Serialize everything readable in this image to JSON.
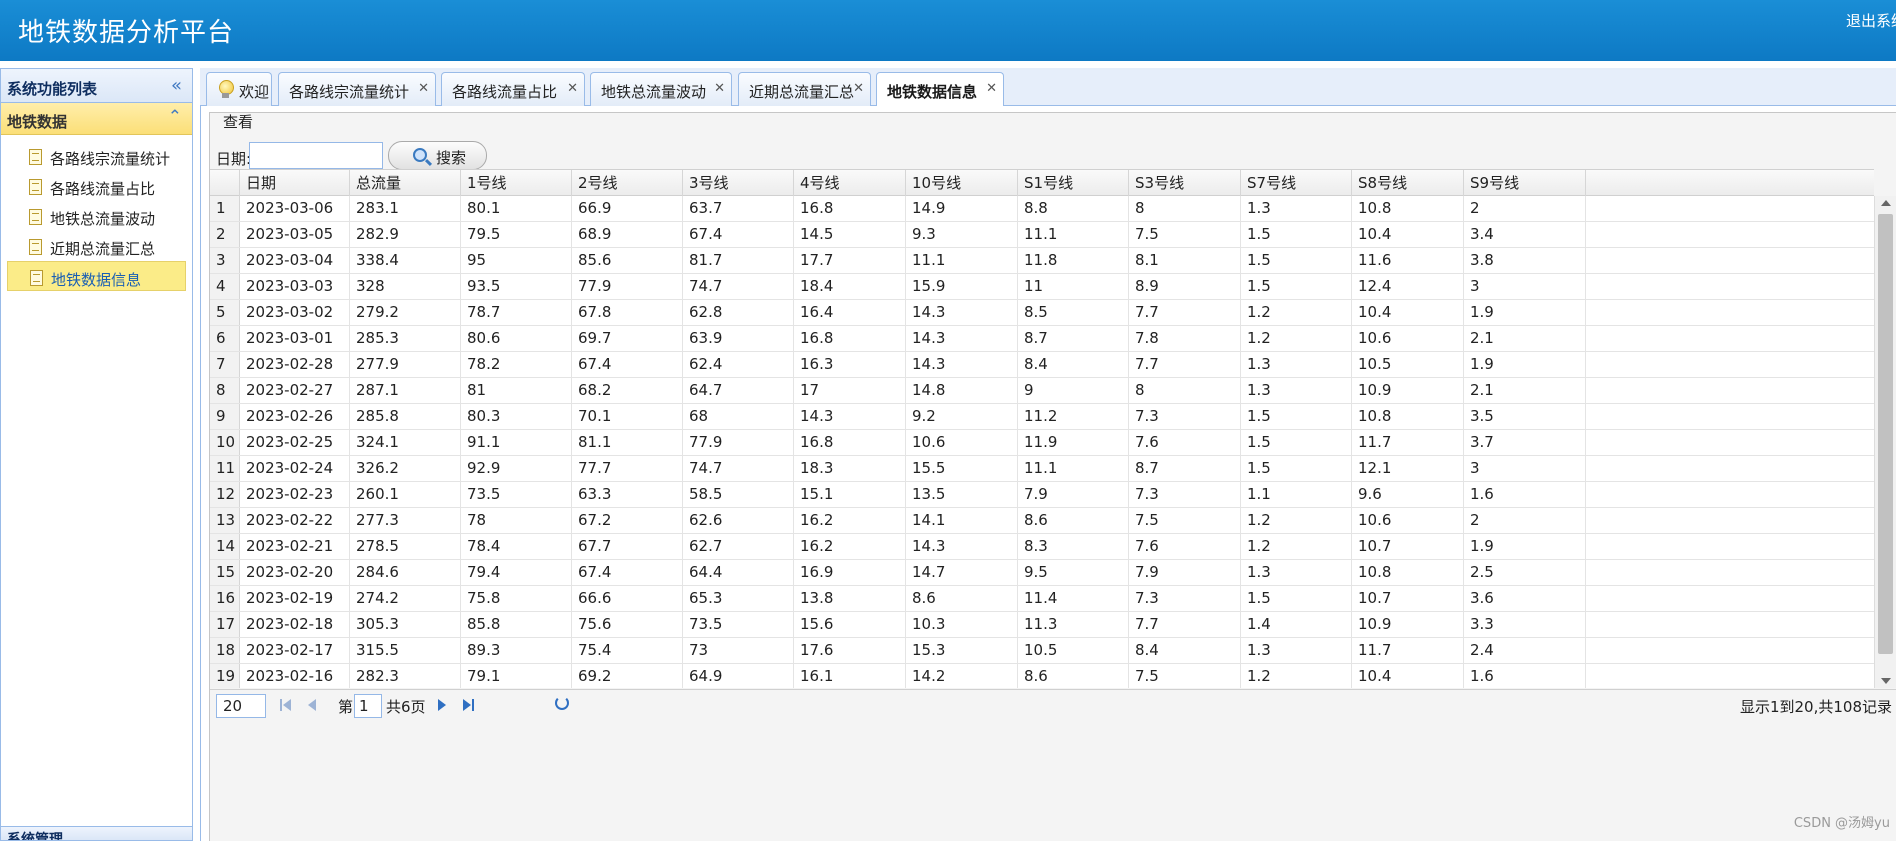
{
  "header": {
    "title": "地铁数据分析平台",
    "logout": "退出系统"
  },
  "sidebar": {
    "title": "系统功能列表",
    "group": "地铁数据",
    "items": [
      {
        "label": "各路线宗流量统计"
      },
      {
        "label": "各路线流量占比"
      },
      {
        "label": "地铁总流量波动"
      },
      {
        "label": "近期总流量汇总"
      },
      {
        "label": "地铁数据信息"
      }
    ],
    "bottom_group": "系统管理"
  },
  "tabs": [
    {
      "label": "欢迎"
    },
    {
      "label": "各路线宗流量统计"
    },
    {
      "label": "各路线流量占比"
    },
    {
      "label": "地铁总流量波动"
    },
    {
      "label": "近期总流量汇总"
    },
    {
      "label": "地铁数据信息"
    }
  ],
  "grid": {
    "title": "查看",
    "date_label": "日期:",
    "date_value": "",
    "search_label": "搜索",
    "columns": [
      "日期",
      "总流量",
      "1号线",
      "2号线",
      "3号线",
      "4号线",
      "10号线",
      "S1号线",
      "S3号线",
      "S7号线",
      "S8号线",
      "S9号线"
    ],
    "rows": [
      [
        "1",
        "2023-03-06",
        "283.1",
        "80.1",
        "66.9",
        "63.7",
        "16.8",
        "14.9",
        "8.8",
        "8",
        "1.3",
        "10.8",
        "2"
      ],
      [
        "2",
        "2023-03-05",
        "282.9",
        "79.5",
        "68.9",
        "67.4",
        "14.5",
        "9.3",
        "11.1",
        "7.5",
        "1.5",
        "10.4",
        "3.4"
      ],
      [
        "3",
        "2023-03-04",
        "338.4",
        "95",
        "85.6",
        "81.7",
        "17.7",
        "11.1",
        "11.8",
        "8.1",
        "1.5",
        "11.6",
        "3.8"
      ],
      [
        "4",
        "2023-03-03",
        "328",
        "93.5",
        "77.9",
        "74.7",
        "18.4",
        "15.9",
        "11",
        "8.9",
        "1.5",
        "12.4",
        "3"
      ],
      [
        "5",
        "2023-03-02",
        "279.2",
        "78.7",
        "67.8",
        "62.8",
        "16.4",
        "14.3",
        "8.5",
        "7.7",
        "1.2",
        "10.4",
        "1.9"
      ],
      [
        "6",
        "2023-03-01",
        "285.3",
        "80.6",
        "69.7",
        "63.9",
        "16.8",
        "14.3",
        "8.7",
        "7.8",
        "1.2",
        "10.6",
        "2.1"
      ],
      [
        "7",
        "2023-02-28",
        "277.9",
        "78.2",
        "67.4",
        "62.4",
        "16.3",
        "14.3",
        "8.4",
        "7.7",
        "1.3",
        "10.5",
        "1.9"
      ],
      [
        "8",
        "2023-02-27",
        "287.1",
        "81",
        "68.2",
        "64.7",
        "17",
        "14.8",
        "9",
        "8",
        "1.3",
        "10.9",
        "2.1"
      ],
      [
        "9",
        "2023-02-26",
        "285.8",
        "80.3",
        "70.1",
        "68",
        "14.3",
        "9.2",
        "11.2",
        "7.3",
        "1.5",
        "10.8",
        "3.5"
      ],
      [
        "10",
        "2023-02-25",
        "324.1",
        "91.1",
        "81.1",
        "77.9",
        "16.8",
        "10.6",
        "11.9",
        "7.6",
        "1.5",
        "11.7",
        "3.7"
      ],
      [
        "11",
        "2023-02-24",
        "326.2",
        "92.9",
        "77.7",
        "74.7",
        "18.3",
        "15.5",
        "11.1",
        "8.7",
        "1.5",
        "12.1",
        "3"
      ],
      [
        "12",
        "2023-02-23",
        "260.1",
        "73.5",
        "63.3",
        "58.5",
        "15.1",
        "13.5",
        "7.9",
        "7.3",
        "1.1",
        "9.6",
        "1.6"
      ],
      [
        "13",
        "2023-02-22",
        "277.3",
        "78",
        "67.2",
        "62.6",
        "16.2",
        "14.1",
        "8.6",
        "7.5",
        "1.2",
        "10.6",
        "2"
      ],
      [
        "14",
        "2023-02-21",
        "278.5",
        "78.4",
        "67.7",
        "62.7",
        "16.2",
        "14.3",
        "8.3",
        "7.6",
        "1.2",
        "10.7",
        "1.9"
      ],
      [
        "15",
        "2023-02-20",
        "284.6",
        "79.4",
        "67.4",
        "64.4",
        "16.9",
        "14.7",
        "9.5",
        "7.9",
        "1.3",
        "10.8",
        "2.5"
      ],
      [
        "16",
        "2023-02-19",
        "274.2",
        "75.8",
        "66.6",
        "65.3",
        "13.8",
        "8.6",
        "11.4",
        "7.3",
        "1.5",
        "10.7",
        "3.6"
      ],
      [
        "17",
        "2023-02-18",
        "305.3",
        "85.8",
        "75.6",
        "73.5",
        "15.6",
        "10.3",
        "11.3",
        "7.7",
        "1.4",
        "10.9",
        "3.3"
      ],
      [
        "18",
        "2023-02-17",
        "315.5",
        "89.3",
        "75.4",
        "73",
        "17.6",
        "15.3",
        "10.5",
        "8.4",
        "1.3",
        "11.7",
        "2.4"
      ],
      [
        "19",
        "2023-02-16",
        "282.3",
        "79.1",
        "69.2",
        "64.9",
        "16.1",
        "14.2",
        "8.6",
        "7.5",
        "1.2",
        "10.4",
        "1.6"
      ]
    ]
  },
  "pager": {
    "page_size": "20",
    "page_prefix": "第",
    "page_number": "1",
    "page_suffix": "共6页",
    "info": "显示1到20,共108记录"
  },
  "watermark": "CSDN @汤姆yu"
}
